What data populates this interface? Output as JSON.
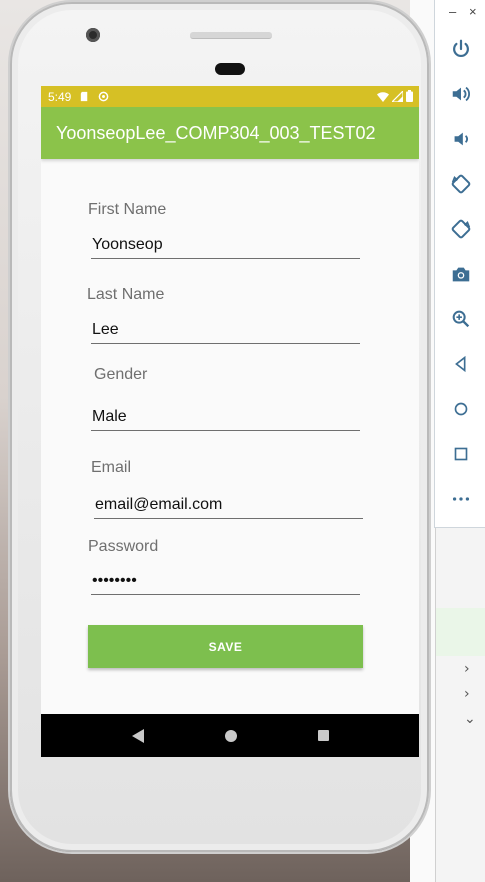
{
  "status_bar": {
    "time": "5:49"
  },
  "app": {
    "title": "YoonseopLee_COMP304_003_TEST02"
  },
  "form": {
    "first_name": {
      "label": "First Name",
      "value": "Yoonseop"
    },
    "last_name": {
      "label": "Last Name",
      "value": "Lee"
    },
    "gender": {
      "label": "Gender",
      "value": "Male"
    },
    "email": {
      "label": "Email",
      "value": "email@email.com"
    },
    "password": {
      "label": "Password",
      "value": "••••••••"
    },
    "save_label": "SAVE"
  },
  "colors": {
    "status_bar": "#d6c025",
    "app_bar": "#8bc34a",
    "button": "#7dbf4e"
  },
  "emulator_toolbar": {
    "minimize": "–",
    "close": "×",
    "buttons": [
      "power-icon",
      "volume-up-icon",
      "volume-down-icon",
      "rotate-left-icon",
      "rotate-right-icon",
      "camera-icon",
      "zoom-icon",
      "back-icon",
      "home-icon",
      "overview-icon",
      "more-icon"
    ]
  }
}
